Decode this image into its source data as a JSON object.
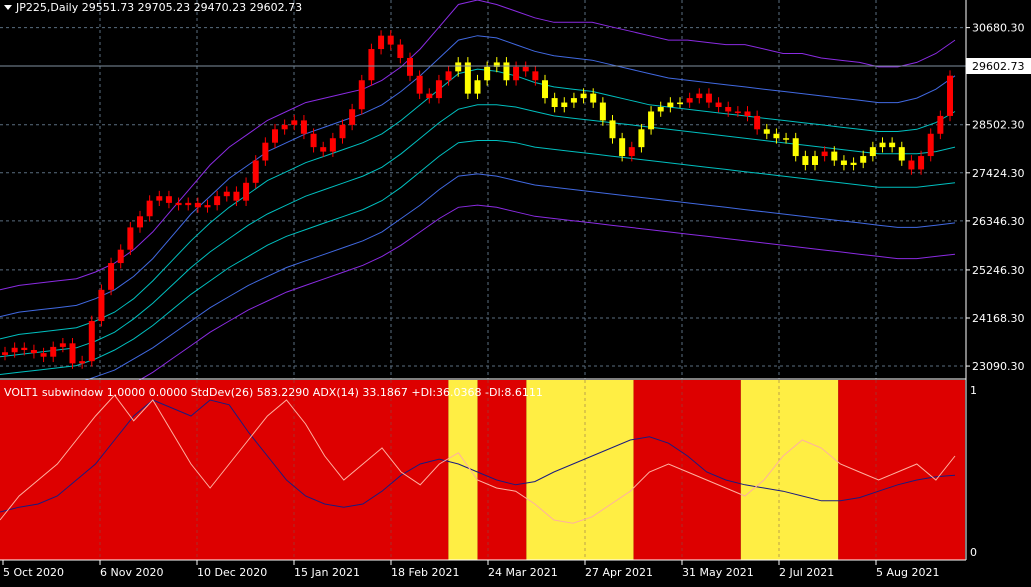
{
  "symbol_header": "JP225,Daily  29551.73 29705.23 29470.23 29602.73",
  "current_price_label": "29602.73",
  "indicator_header": "VOLT1 subwindow 1.0000 0.0000  StdDev(26) 583.2290  ADX(14) 33.1867 +DI:36.0368 -DI:8.6111",
  "colors": {
    "background": "#000000",
    "bull_candle": "#ff0000",
    "signal_candle": "#ffff00",
    "band_outer": "#8a2be2",
    "band_mid": "#4169e1",
    "band_inner": "#00bfbf",
    "regime_red": "#dd0000",
    "regime_yellow": "#ffee44",
    "stddev_line": "#1a1a80",
    "adx_line": "#ffb0a0",
    "grid": "#5a6e80"
  },
  "chart_data": [
    {
      "type": "candlestick",
      "yticks": [
        "30680.30",
        "29602.73",
        "28502.30",
        "27424.30",
        "26346.30",
        "25246.30",
        "24168.30",
        "23090.30"
      ],
      "ylim": [
        22800,
        31300
      ],
      "xticks": [
        "5 Oct 2020",
        "6 Nov 2020",
        "10 Dec 2020",
        "15 Jan 2021",
        "18 Feb 2021",
        "24 Mar 2021",
        "27 Apr 2021",
        "31 May 2021",
        "2 Jul 2021",
        "5 Aug 2021"
      ],
      "close_series": [
        23400,
        23500,
        23450,
        23380,
        23300,
        23520,
        23600,
        23150,
        23200,
        24100,
        24800,
        25400,
        25700,
        26200,
        26450,
        26800,
        26900,
        26750,
        26700,
        26750,
        26650,
        26700,
        26900,
        27000,
        26800,
        27200,
        27700,
        28100,
        28400,
        28500,
        28600,
        28300,
        28000,
        27900,
        28200,
        28500,
        28850,
        29500,
        30200,
        30500,
        30300,
        30000,
        29600,
        29200,
        29100,
        29500,
        29700,
        29900,
        29200,
        29500,
        29800,
        29900,
        29500,
        29800,
        29700,
        29500,
        29100,
        28900,
        29000,
        29100,
        29200,
        29000,
        28600,
        28200,
        27800,
        28000,
        28400,
        28800,
        28900,
        29000,
        29000,
        29100,
        29200,
        29000,
        28900,
        28800,
        28800,
        28700,
        28400,
        28300,
        28200,
        28200,
        27800,
        27600,
        27800,
        27900,
        27700,
        27600,
        27650,
        27800,
        28000,
        28100,
        28000,
        27700,
        27500,
        27800,
        28300,
        28700,
        29602.73
      ],
      "signal_ranges": [
        [
          47,
          52
        ],
        [
          56,
          64
        ],
        [
          66,
          70
        ],
        [
          79,
          84
        ],
        [
          86,
          93
        ]
      ],
      "bands": {
        "upper_outer": [
          24800,
          24900,
          24950,
          25000,
          25050,
          25200,
          25400,
          25700,
          26100,
          26600,
          27100,
          27600,
          28000,
          28300,
          28600,
          28800,
          29000,
          29100,
          29200,
          29300,
          29500,
          29800,
          30200,
          30700,
          31200,
          31300,
          31200,
          31050,
          30900,
          30800,
          30800,
          30800,
          30700,
          30600,
          30500,
          30400,
          30400,
          30350,
          30300,
          30300,
          30200,
          30100,
          30100,
          30000,
          29950,
          29900,
          29800,
          29800,
          29900,
          30100,
          30400
        ],
        "upper_mid": [
          24200,
          24300,
          24350,
          24400,
          24450,
          24600,
          24800,
          25100,
          25500,
          26000,
          26500,
          26900,
          27300,
          27600,
          27900,
          28100,
          28300,
          28450,
          28600,
          28750,
          28950,
          29250,
          29600,
          30000,
          30400,
          30500,
          30450,
          30300,
          30150,
          30050,
          30000,
          29950,
          29850,
          29750,
          29650,
          29550,
          29500,
          29450,
          29400,
          29350,
          29300,
          29250,
          29200,
          29150,
          29100,
          29050,
          29000,
          29000,
          29100,
          29300,
          29600
        ],
        "upper_inner": [
          23700,
          23800,
          23850,
          23900,
          23950,
          24100,
          24300,
          24600,
          25000,
          25450,
          25900,
          26300,
          26650,
          26950,
          27250,
          27450,
          27650,
          27800,
          27950,
          28100,
          28300,
          28600,
          28950,
          29300,
          29650,
          29750,
          29700,
          29600,
          29450,
          29350,
          29300,
          29250,
          29150,
          29050,
          28950,
          28900,
          28850,
          28800,
          28750,
          28700,
          28650,
          28600,
          28550,
          28500,
          28450,
          28400,
          28350,
          28350,
          28400,
          28550,
          28800
        ],
        "center": [
          23300,
          23350,
          23400,
          23450,
          23500,
          23650,
          23850,
          24150,
          24500,
          24900,
          25300,
          25650,
          25950,
          26250,
          26500,
          26700,
          26900,
          27050,
          27200,
          27350,
          27550,
          27850,
          28200,
          28550,
          28850,
          28950,
          28950,
          28900,
          28800,
          28700,
          28650,
          28600,
          28550,
          28500,
          28450,
          28400,
          28350,
          28300,
          28250,
          28200,
          28150,
          28100,
          28050,
          28000,
          27950,
          27900,
          27850,
          27850,
          27850,
          27900,
          28000
        ],
        "lower_inner": [
          22900,
          22950,
          23000,
          23050,
          23100,
          23250,
          23450,
          23700,
          24000,
          24350,
          24700,
          25000,
          25300,
          25550,
          25800,
          26000,
          26150,
          26300,
          26450,
          26600,
          26800,
          27100,
          27450,
          27800,
          28100,
          28150,
          28150,
          28100,
          28000,
          27950,
          27900,
          27850,
          27800,
          27750,
          27700,
          27650,
          27600,
          27550,
          27500,
          27450,
          27400,
          27350,
          27300,
          27250,
          27200,
          27150,
          27100,
          27100,
          27100,
          27150,
          27200
        ],
        "lower_mid": [
          22500,
          22550,
          22600,
          22650,
          22700,
          22850,
          23000,
          23250,
          23500,
          23800,
          24100,
          24400,
          24650,
          24900,
          25100,
          25300,
          25450,
          25600,
          25750,
          25900,
          26100,
          26400,
          26700,
          27050,
          27350,
          27400,
          27350,
          27250,
          27150,
          27100,
          27050,
          27000,
          26950,
          26900,
          26850,
          26800,
          26750,
          26700,
          26650,
          26600,
          26550,
          26500,
          26450,
          26400,
          26350,
          26300,
          26250,
          26200,
          26200,
          26250,
          26300
        ],
        "lower_outer": [
          22000,
          22050,
          22100,
          22150,
          22200,
          22350,
          22500,
          22700,
          22950,
          23250,
          23550,
          23850,
          24100,
          24350,
          24550,
          24750,
          24900,
          25050,
          25200,
          25350,
          25550,
          25800,
          26100,
          26400,
          26650,
          26700,
          26650,
          26550,
          26450,
          26400,
          26350,
          26300,
          26250,
          26200,
          26150,
          26100,
          26050,
          26000,
          25950,
          25900,
          25850,
          25800,
          25750,
          25700,
          25650,
          25600,
          25550,
          25500,
          25500,
          25550,
          25600
        ]
      }
    },
    {
      "type": "line",
      "ylim": [
        0,
        1
      ],
      "yticks": [
        "1",
        "0"
      ],
      "regimes": [
        {
          "state": "red",
          "from": 0,
          "to": 46
        },
        {
          "state": "yellow",
          "from": 46,
          "to": 49
        },
        {
          "state": "red",
          "from": 49,
          "to": 54
        },
        {
          "state": "yellow",
          "from": 54,
          "to": 65
        },
        {
          "state": "red",
          "from": 65,
          "to": 76
        },
        {
          "state": "yellow",
          "from": 76,
          "to": 86
        },
        {
          "state": "red",
          "from": 86,
          "to": 99
        }
      ],
      "series": [
        {
          "values": [
            0.25,
            0.28,
            0.3,
            0.35,
            0.45,
            0.55,
            0.7,
            0.85,
            0.95,
            0.9,
            0.85,
            0.95,
            0.92,
            0.75,
            0.6,
            0.45,
            0.35,
            0.3,
            0.28,
            0.3,
            0.38,
            0.48,
            0.55,
            0.58,
            0.55,
            0.5,
            0.45,
            0.42,
            0.44,
            0.5,
            0.55,
            0.6,
            0.65,
            0.7,
            0.72,
            0.68,
            0.6,
            0.5,
            0.45,
            0.42,
            0.4,
            0.38,
            0.35,
            0.32,
            0.32,
            0.34,
            0.38,
            0.42,
            0.45,
            0.47,
            0.48
          ]
        },
        {
          "values": [
            0.2,
            0.35,
            0.45,
            0.55,
            0.7,
            0.85,
            0.98,
            0.82,
            0.95,
            0.75,
            0.55,
            0.4,
            0.55,
            0.7,
            0.85,
            0.95,
            0.8,
            0.6,
            0.45,
            0.55,
            0.65,
            0.5,
            0.42,
            0.55,
            0.62,
            0.45,
            0.4,
            0.38,
            0.3,
            0.2,
            0.18,
            0.22,
            0.3,
            0.38,
            0.5,
            0.55,
            0.5,
            0.45,
            0.4,
            0.35,
            0.45,
            0.6,
            0.7,
            0.65,
            0.55,
            0.5,
            0.45,
            0.5,
            0.55,
            0.45,
            0.6
          ]
        }
      ]
    }
  ]
}
